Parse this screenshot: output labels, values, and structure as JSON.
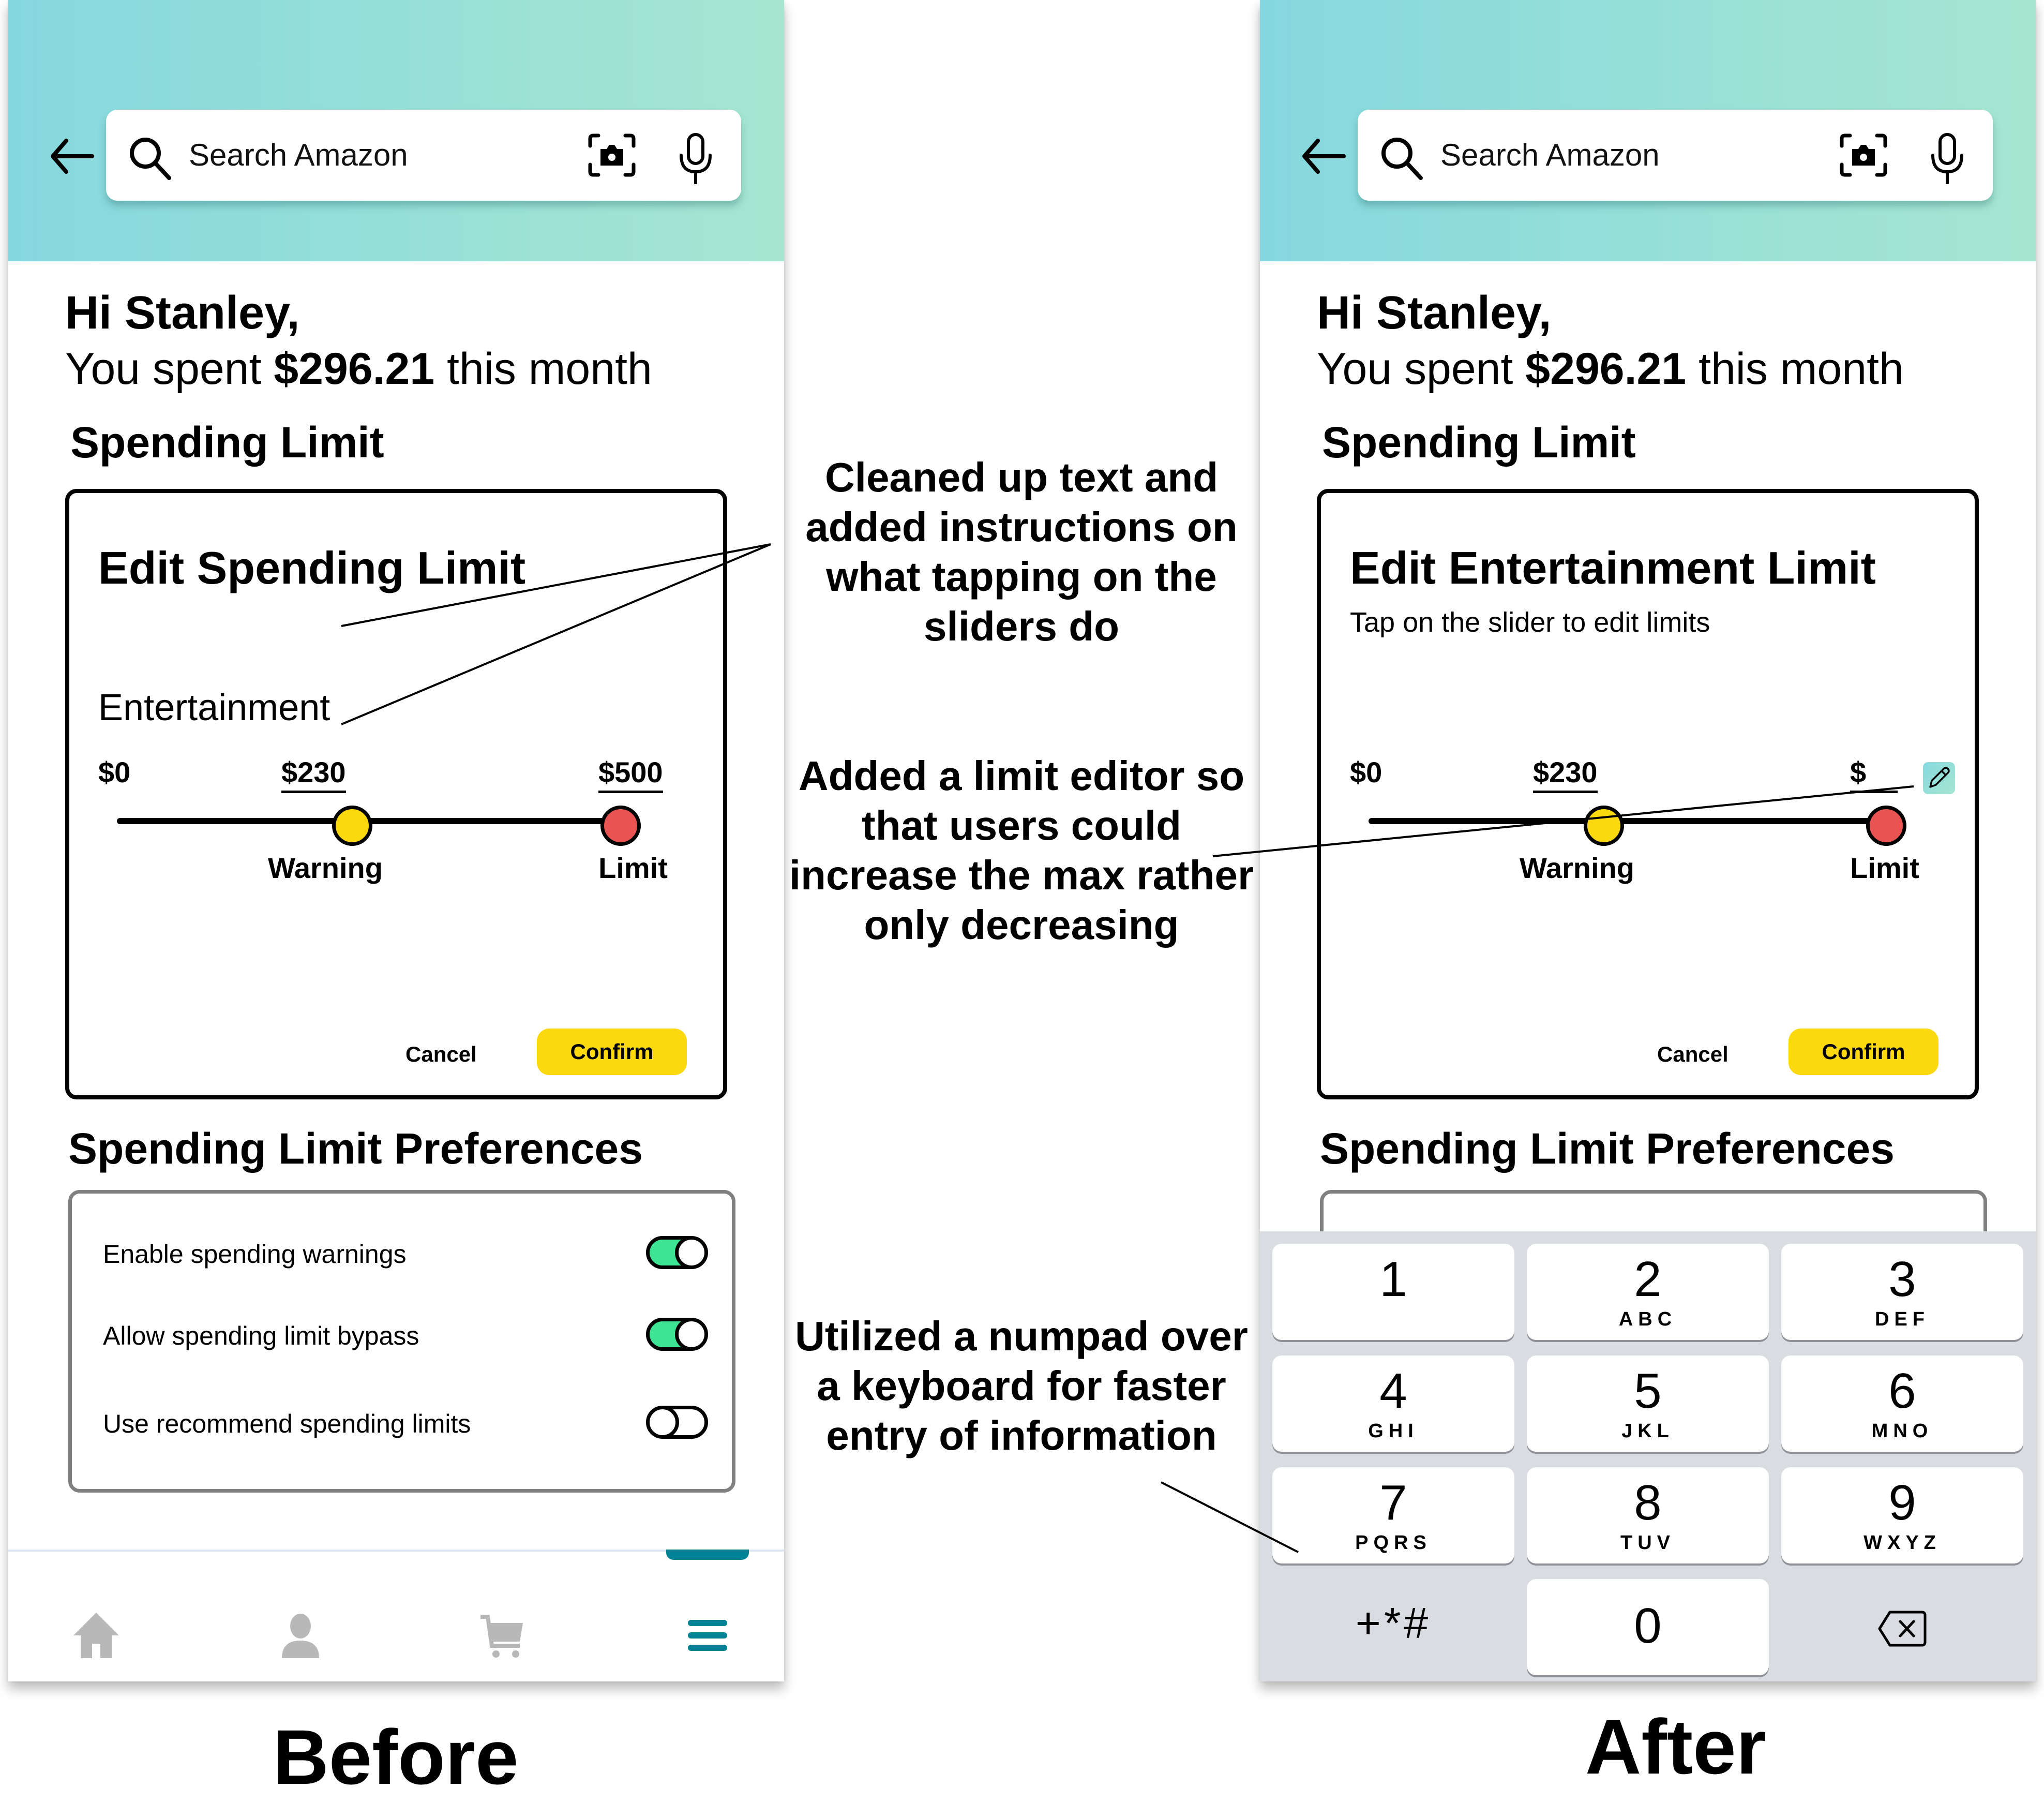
{
  "before": {
    "search": {
      "placeholder": "Search Amazon"
    },
    "greeting": "Hi Stanley,",
    "spent_prefix": "You spent ",
    "spent_amount": "$296.21",
    "spent_suffix": " this month",
    "spending_limit_title": "Spending Limit",
    "card": {
      "title": "Edit Spending Limit",
      "category": "Entertainment",
      "slider": {
        "min_label": "$0",
        "warning_value_label": "$230",
        "limit_value_label": "$500",
        "warning_label": "Warning",
        "limit_label": "Limit",
        "min": 0,
        "max": 500,
        "warning": 230,
        "limit": 500
      },
      "cancel_label": "Cancel",
      "confirm_label": "Confirm"
    },
    "preferences_title": "Spending Limit Preferences",
    "preferences": [
      {
        "label": "Enable spending warnings",
        "enabled": true
      },
      {
        "label": "Allow spending limit bypass",
        "enabled": true
      },
      {
        "label": "Use recommend spending limits",
        "enabled": false
      }
    ],
    "nav": [
      {
        "icon": "home-icon",
        "active": false
      },
      {
        "icon": "account-icon",
        "active": false
      },
      {
        "icon": "cart-icon",
        "active": false
      },
      {
        "icon": "menu-icon",
        "active": true
      }
    ],
    "caption": "Before"
  },
  "after": {
    "search": {
      "placeholder": "Search Amazon"
    },
    "greeting": "Hi Stanley,",
    "spent_prefix": "You spent ",
    "spent_amount": "$296.21",
    "spent_suffix": " this month",
    "spending_limit_title": "Spending Limit",
    "card": {
      "title": "Edit Entertainment Limit",
      "subtitle": "Tap on the slider to edit limits",
      "slider": {
        "min_label": "$0",
        "warning_value_label": "$230",
        "limit_value_label": "$",
        "warning_label": "Warning",
        "limit_label": "Limit",
        "min": 0,
        "warning": 230
      },
      "cancel_label": "Cancel",
      "confirm_label": "Confirm"
    },
    "preferences_title": "Spending Limit Preferences",
    "keypad": [
      {
        "num": "1",
        "letters": ""
      },
      {
        "num": "2",
        "letters": "ABC"
      },
      {
        "num": "3",
        "letters": "DEF"
      },
      {
        "num": "4",
        "letters": "GHI"
      },
      {
        "num": "5",
        "letters": "JKL"
      },
      {
        "num": "6",
        "letters": "MNO"
      },
      {
        "num": "7",
        "letters": "PQRS"
      },
      {
        "num": "8",
        "letters": "TUV"
      },
      {
        "num": "9",
        "letters": "WXYZ"
      },
      {
        "num": "+*#",
        "letters": ""
      },
      {
        "num": "0",
        "letters": ""
      },
      {
        "num": "delete",
        "letters": ""
      }
    ],
    "caption": "After"
  },
  "annotations": [
    "Cleaned up text and added instructions on what tapping on the sliders do",
    "Added a limit editor so that users could increase the max rather only decreasing",
    "Utilized a numpad over a keyboard for faster entry of information"
  ],
  "colors": {
    "header_start": "#86d8df",
    "header_end": "#a6e6d1",
    "warning": "#fcd80f",
    "limit": "#e95453",
    "toggle_on": "#3de494",
    "nav_active": "#008394",
    "nav_inactive": "#b8b8b8",
    "keyboard_bg": "#d9dce1"
  }
}
